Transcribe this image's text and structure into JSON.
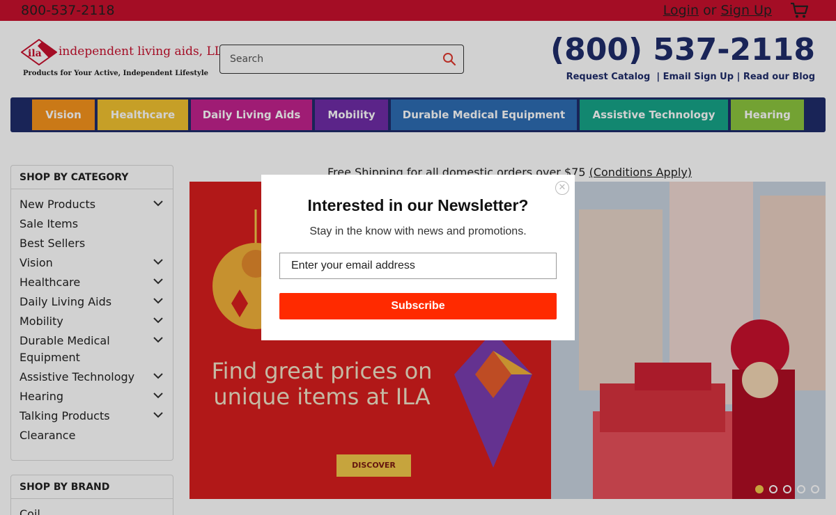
{
  "topbar": {
    "phone": "800-537-2118",
    "login_label": "Login",
    "or_text": "or",
    "signup_label": "Sign Up",
    "cart_icon": "cart-icon"
  },
  "header": {
    "logo_mark": "ila",
    "logo_name": "independent living aids, LLC",
    "logo_tagline": "Products for Your Active, Independent Lifestyle",
    "search_placeholder": "Search",
    "phone_large": "(800) 537-2118",
    "links": [
      "Request Catalog",
      "Email Sign Up",
      "Read our Blog"
    ],
    "link_separator": "|"
  },
  "nav": {
    "items": [
      {
        "label": "Vision",
        "color": "#f7941d"
      },
      {
        "label": "Healthcare",
        "color": "#f2c230"
      },
      {
        "label": "Daily Living Aids",
        "color": "#c2238e"
      },
      {
        "label": "Mobility",
        "color": "#6f2da8"
      },
      {
        "label": "Durable Medical Equipment",
        "color": "#2e6db4"
      },
      {
        "label": "Assistive Technology",
        "color": "#17a589"
      },
      {
        "label": "Hearing",
        "color": "#8dc63f"
      }
    ]
  },
  "sidebar": {
    "category_heading": "SHOP BY CATEGORY",
    "categories": [
      {
        "label": "New Products",
        "expandable": true
      },
      {
        "label": "Sale Items",
        "expandable": false
      },
      {
        "label": "Best Sellers",
        "expandable": false
      },
      {
        "label": "Vision",
        "expandable": true
      },
      {
        "label": "Healthcare",
        "expandable": true
      },
      {
        "label": "Daily Living Aids",
        "expandable": true
      },
      {
        "label": "Mobility",
        "expandable": true
      },
      {
        "label": "Durable Medical Equipment",
        "expandable": true
      },
      {
        "label": "Assistive Technology",
        "expandable": true
      },
      {
        "label": "Hearing",
        "expandable": true
      },
      {
        "label": "Talking Products",
        "expandable": true
      },
      {
        "label": "Clearance",
        "expandable": false
      }
    ],
    "brand_heading": "SHOP BY BRAND",
    "brand_first": "Coil"
  },
  "main": {
    "shipping_text": "Free Shipping for all domestic orders over $75",
    "shipping_link": "(Conditions Apply)",
    "banner_headline_line1": "Find great prices on",
    "banner_headline_line2": "unique items at ILA",
    "banner_button": "DISCOVER",
    "slides_total": 5,
    "slide_active": 1
  },
  "modal": {
    "title": "Interested in our Newsletter?",
    "subtitle": "Stay in the know with news and promotions.",
    "email_placeholder": "Enter your email address",
    "subscribe_label": "Subscribe",
    "close_icon": "close-icon",
    "button_color": "#ff2a00"
  },
  "colors": {
    "topbar": "#c8102e",
    "brand_navy": "#1f2d6b",
    "brand_red": "#c8102e"
  }
}
